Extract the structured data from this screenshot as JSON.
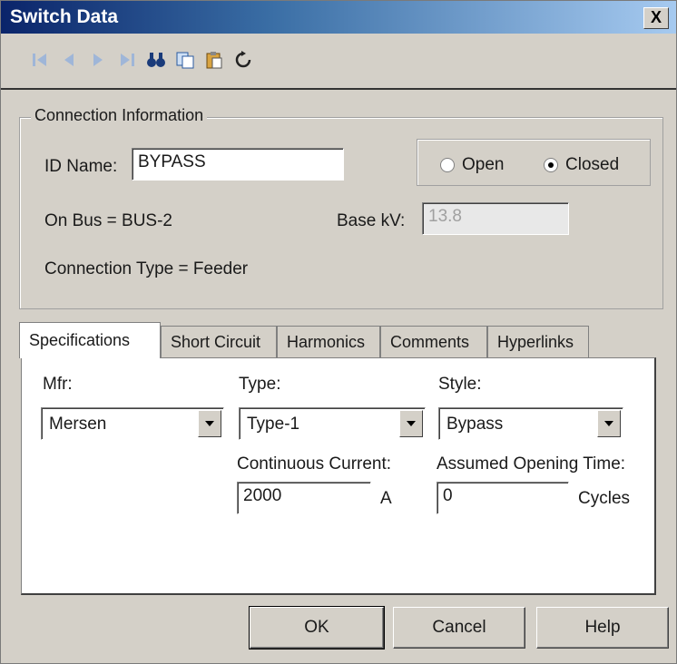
{
  "window": {
    "title": "Switch Data",
    "close_label": "X"
  },
  "toolbar": {
    "icons": [
      "first-record-icon",
      "previous-record-icon",
      "next-record-icon",
      "last-record-icon",
      "find-icon",
      "copy-icon",
      "paste-icon",
      "refresh-icon"
    ]
  },
  "connection": {
    "legend": "Connection Information",
    "id_label": "ID Name:",
    "id_value": "BYPASS",
    "on_bus": "On Bus =  BUS-2",
    "connection_type": "Connection Type =  Feeder",
    "base_kv_label": "Base kV:",
    "base_kv_value": "13.8",
    "radio_open": "Open",
    "radio_closed": "Closed",
    "selected": "Closed"
  },
  "tabs": [
    "Specifications",
    "Short Circuit",
    "Harmonics",
    "Comments",
    "Hyperlinks"
  ],
  "specs": {
    "mfr_label": "Mfr:",
    "mfr_value": "Mersen",
    "type_label": "Type:",
    "type_value": "Type-1",
    "style_label": "Style:",
    "style_value": "Bypass",
    "current_label": "Continuous Current:",
    "current_value": "2000",
    "current_unit": "A",
    "opening_label": "Assumed Opening Time:",
    "opening_value": "0",
    "opening_unit": "Cycles"
  },
  "buttons": {
    "ok": "OK",
    "cancel": "Cancel",
    "help": "Help"
  }
}
